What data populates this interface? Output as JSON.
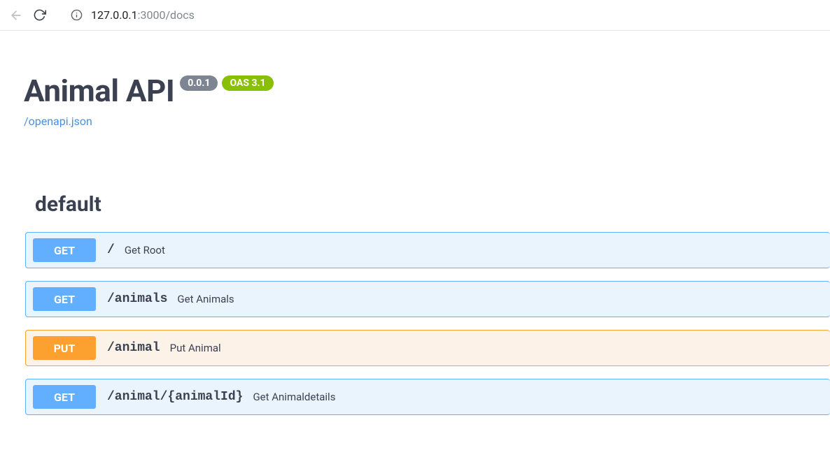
{
  "browser": {
    "url_host": "127.0.0.1",
    "url_port_path": ":3000/docs"
  },
  "api": {
    "title": "Animal API",
    "version": "0.0.1",
    "oas_version": "OAS 3.1",
    "openapi_link": "/openapi.json"
  },
  "section": {
    "name": "default"
  },
  "operations": [
    {
      "method": "GET",
      "method_class": "get",
      "path": "/",
      "summary": "Get Root"
    },
    {
      "method": "GET",
      "method_class": "get",
      "path": "/animals",
      "summary": "Get Animals"
    },
    {
      "method": "PUT",
      "method_class": "put",
      "path": "/animal",
      "summary": "Put Animal"
    },
    {
      "method": "GET",
      "method_class": "get",
      "path": "/animal/{animalId}",
      "summary": "Get Animaldetails"
    }
  ]
}
